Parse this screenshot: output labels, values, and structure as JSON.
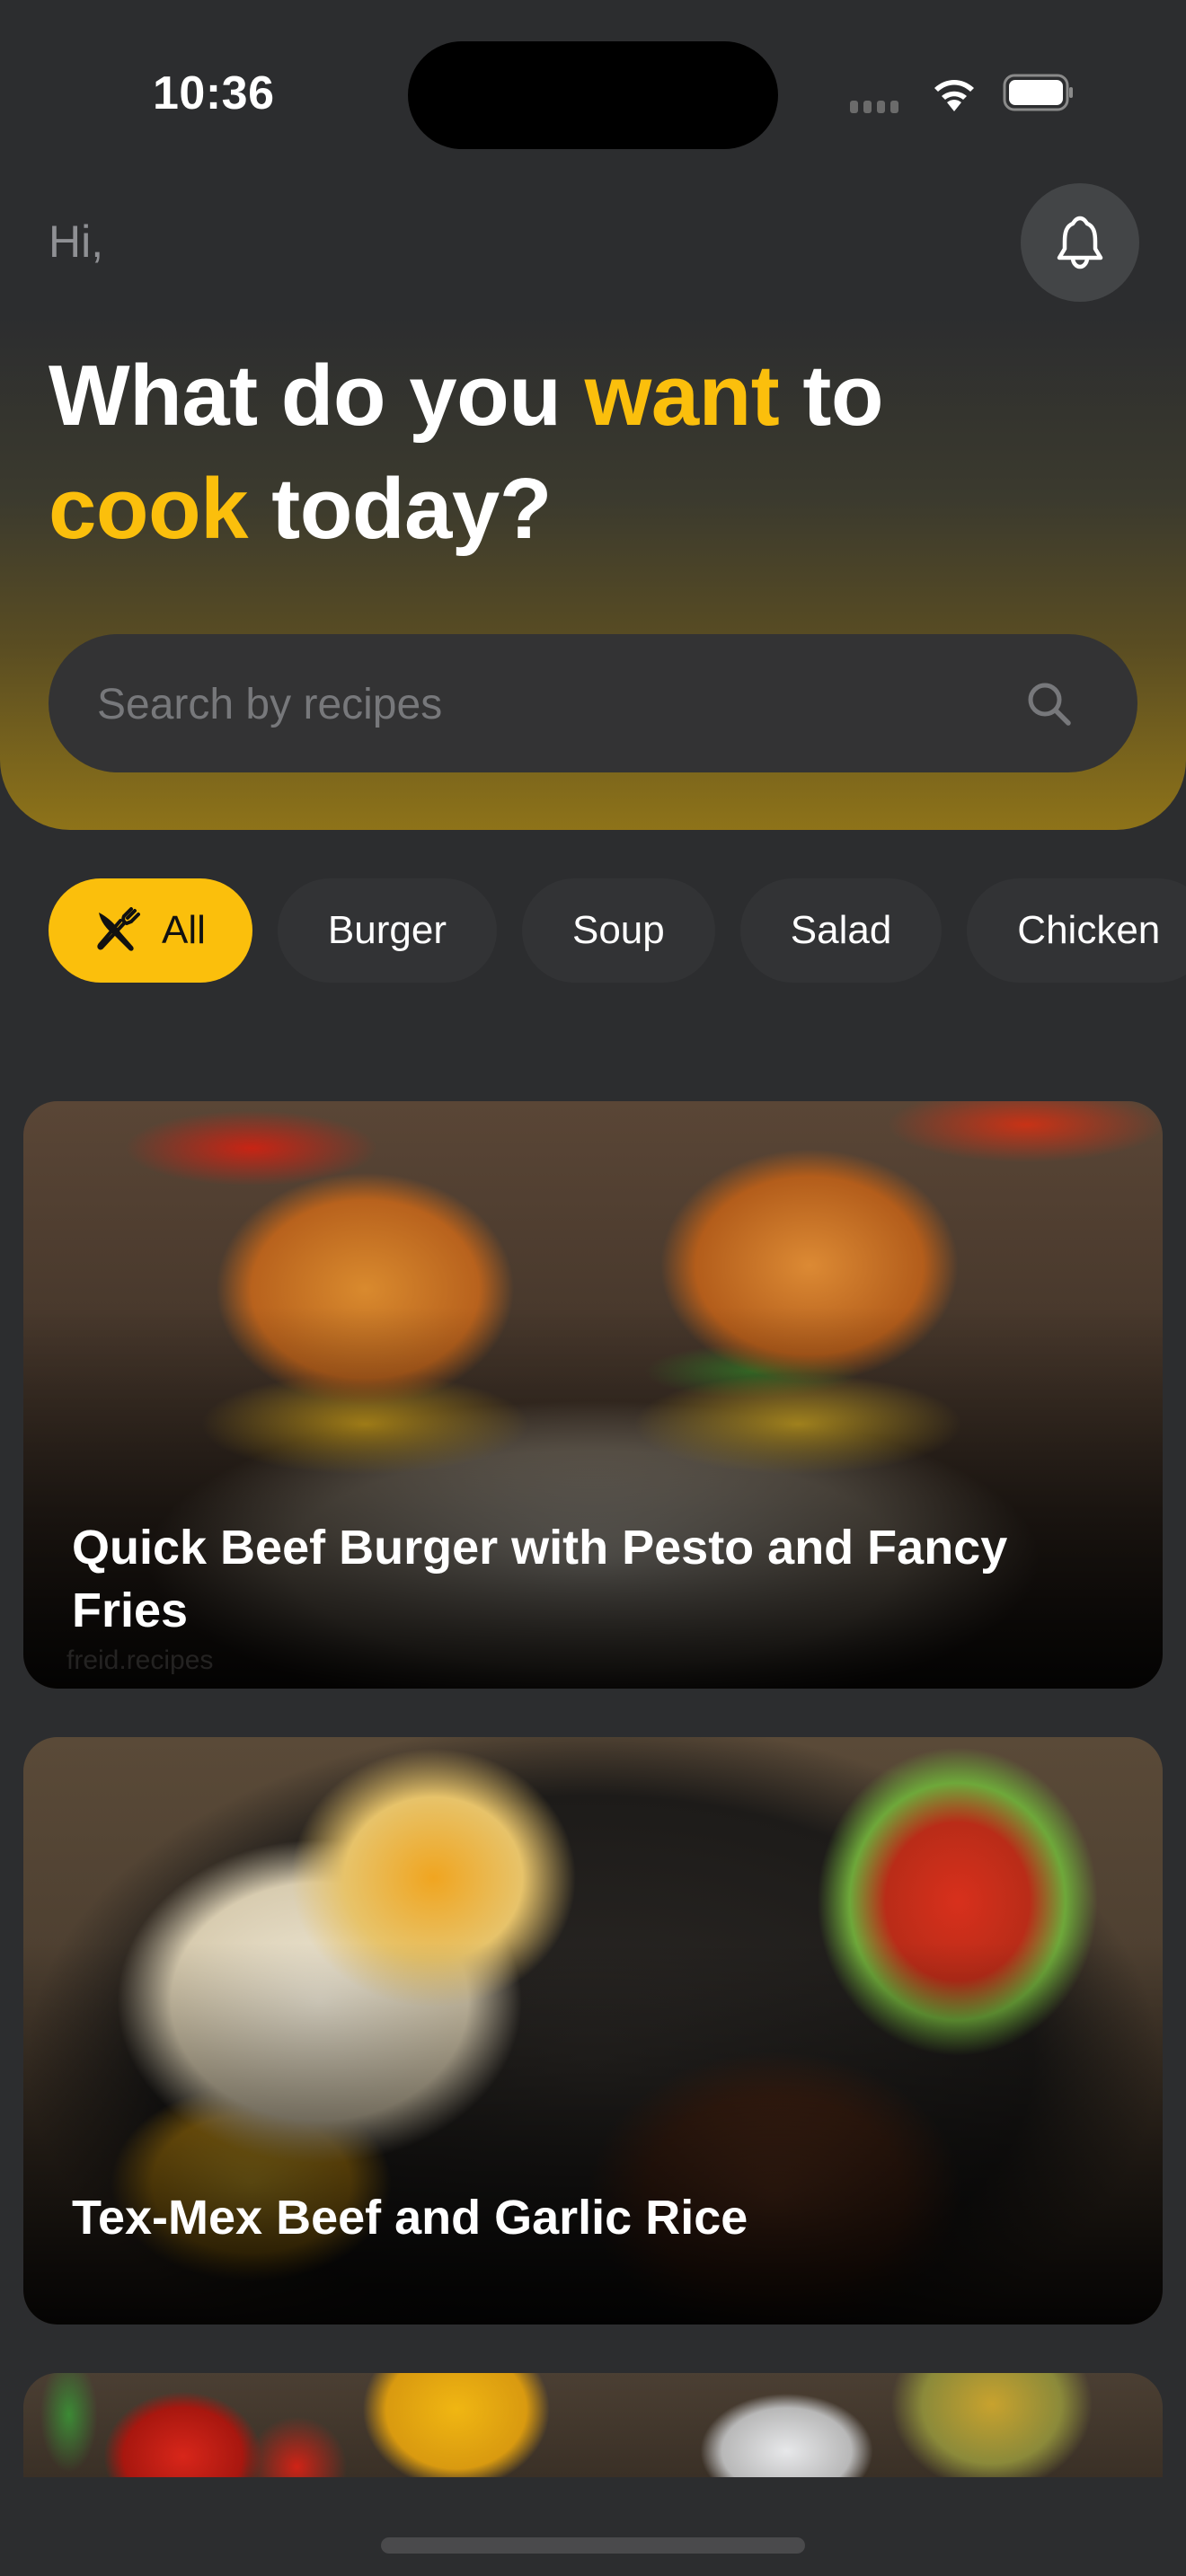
{
  "status_bar": {
    "time": "10:36",
    "icons": [
      "cellular-signal-icon",
      "wifi-icon",
      "battery-icon"
    ]
  },
  "header": {
    "greeting": "Hi,",
    "headline": {
      "part1": "What do you ",
      "accent1": "want",
      "part2": " to",
      "accent2": "cook",
      "part3": " today?"
    },
    "notification_icon": "bell-icon",
    "accent_color": "#fbbf0c"
  },
  "search": {
    "placeholder": "Search by recipes",
    "value": "",
    "icon": "search-icon"
  },
  "categories": {
    "selected": "All",
    "items": [
      {
        "label": "All",
        "icon": "fork-knife-icon",
        "active": true
      },
      {
        "label": "Burger",
        "active": false
      },
      {
        "label": "Soup",
        "active": false
      },
      {
        "label": "Salad",
        "active": false
      },
      {
        "label": "Chicken",
        "active": false
      }
    ]
  },
  "recipes": [
    {
      "title": "Quick Beef Burger with Pesto and Fancy Fries",
      "watermark": "freid.recipes",
      "image": "burgers with cheese, tomato and pesto"
    },
    {
      "title": "Tex-Mex Beef and Garlic Rice",
      "image": "rice bowl with cheese, pico de gallo, corn and sliced beef"
    },
    {
      "title": "",
      "image": "cherry tomatoes, lemon wedge and olive oil"
    }
  ]
}
